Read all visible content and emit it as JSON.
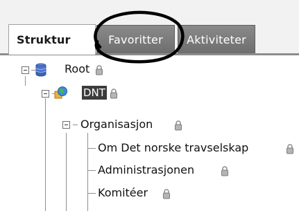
{
  "tabs": [
    {
      "label": "Struktur",
      "state": "active"
    },
    {
      "label": "Favoritter",
      "state": "inactive"
    },
    {
      "label": "Aktiviteter",
      "state": "inactive"
    }
  ],
  "tree": {
    "root": {
      "label": "Root",
      "icon": "database-icon"
    },
    "site": {
      "label": "DNT",
      "icon": "globe-site-icon",
      "selected": true
    },
    "folder": {
      "label": "Organisasjon"
    },
    "children": [
      {
        "label": "Om Det norske travselskap"
      },
      {
        "label": "Administrasjonen"
      },
      {
        "label": "Komitéer"
      }
    ]
  },
  "annotation": {
    "type": "circle",
    "target": "Favoritter",
    "color": "#000000"
  },
  "colors": {
    "tab_inactive": "#7a7a7a",
    "selected_bg": "#3c3c3c",
    "tree_lines": "#8f8f8f"
  }
}
